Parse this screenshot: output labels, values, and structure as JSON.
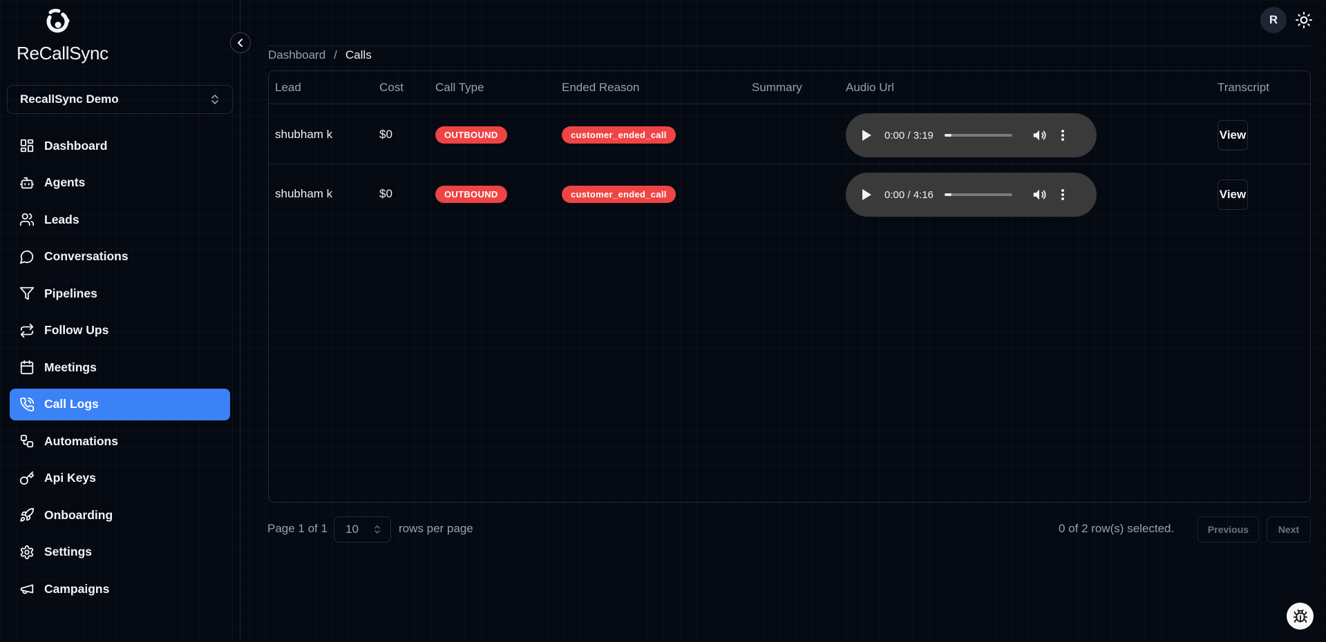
{
  "app": {
    "name": "ReCallSync"
  },
  "org": {
    "selected": "RecallSync Demo"
  },
  "sidebar": {
    "items": [
      {
        "label": "Dashboard",
        "icon": "layout-grid-icon"
      },
      {
        "label": "Agents",
        "icon": "bot-icon"
      },
      {
        "label": "Leads",
        "icon": "users-icon"
      },
      {
        "label": "Conversations",
        "icon": "message-circle-icon"
      },
      {
        "label": "Pipelines",
        "icon": "filter-icon"
      },
      {
        "label": "Follow Ups",
        "icon": "repeat-icon"
      },
      {
        "label": "Meetings",
        "icon": "calendar-icon"
      },
      {
        "label": "Call Logs",
        "icon": "phone-call-icon",
        "active": true
      },
      {
        "label": "Automations",
        "icon": "workflow-icon"
      },
      {
        "label": "Api Keys",
        "icon": "key-icon"
      },
      {
        "label": "Onboarding",
        "icon": "rocket-icon"
      },
      {
        "label": "Settings",
        "icon": "settings-icon"
      },
      {
        "label": "Campaigns",
        "icon": "megaphone-icon"
      }
    ]
  },
  "header": {
    "avatar_initial": "R"
  },
  "breadcrumb": {
    "parent": "Dashboard",
    "separator": "/",
    "current": "Calls"
  },
  "table": {
    "columns": [
      "Lead",
      "Cost",
      "Call Type",
      "Ended Reason",
      "Summary",
      "Audio Url",
      "Transcript"
    ],
    "rows": [
      {
        "lead": "shubham k",
        "cost": "$0",
        "call_type": "OUTBOUND",
        "ended_reason": "customer_ended_call",
        "summary": "",
        "audio_time": "0:00 / 3:19",
        "transcript": "View"
      },
      {
        "lead": "shubham k",
        "cost": "$0",
        "call_type": "OUTBOUND",
        "ended_reason": "customer_ended_call",
        "summary": "",
        "audio_time": "0:00 / 4:16",
        "transcript": "View"
      }
    ]
  },
  "pagination": {
    "page_info": "Page 1 of 1",
    "rows_per_page": "10",
    "rows_per_page_label": "rows per page",
    "selection_info": "0 of 2 row(s) selected.",
    "previous": "Previous",
    "next": "Next"
  },
  "colors": {
    "background": "#050912",
    "accent": "#3b82f6",
    "badge": "#ef4444",
    "player": "#3a3a3a"
  }
}
